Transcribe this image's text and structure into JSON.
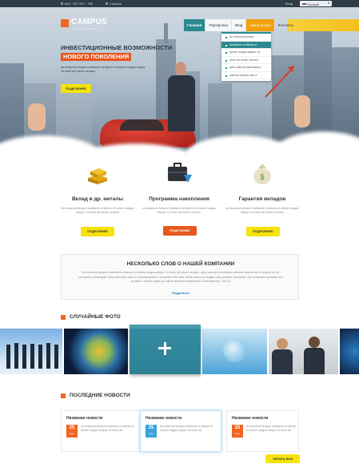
{
  "topbar": {
    "phone": "800 - 567 907 - 785",
    "skype": "Campus",
    "login": "Вход",
    "language": "Русский"
  },
  "brand": {
    "name": "CAMPUS",
    "tagline": "Тема для бизнеса"
  },
  "nav": {
    "items": [
      {
        "label": "Главная",
        "state": "active"
      },
      {
        "label": "Портфолио",
        "state": "normal"
      },
      {
        "label": "Blog",
        "state": "normal"
      },
      {
        "label": "Наши услуги",
        "state": "hover"
      },
      {
        "label": "Контакты",
        "state": "normal"
      }
    ]
  },
  "dropdown": {
    "items": [
      "do eiusmod tempor",
      "incididunt ut labore et",
      "dolore magna aliqua. Ut",
      "enim ad minim veniam,",
      "quis nostrud exercitation",
      "ullamco laboris nisi ut"
    ]
  },
  "hero": {
    "title": "ИНВЕСТИЦИОННЫЕ ВОЗМОЖНОСТИ",
    "accent": "НОВОГО ПОКОЛЕНИЯ",
    "text": "do eiusmod tempor incididunt ut labore et dolore magna aliqua. Ut enim ad minim veniam",
    "button": "ПОДРОБНЕЕ"
  },
  "features": [
    {
      "icon": "gold-bars-icon",
      "title": "Вклад в др. металы",
      "text": "do eiusmod tempor incididunt ut labore et dolore magna aliqua. Ut enim ad minim veniam",
      "button": "ПОДРОБНЕЕ"
    },
    {
      "icon": "briefcase-icon",
      "title": "Программа накопления",
      "text": "do eiusmod tempor incididunt ut labore et dolore magna aliqua. Ut enim ad minim veniam",
      "button": "ПОДРОБНЕЕ"
    },
    {
      "icon": "money-bag-icon",
      "title": "Гарантия вкладов",
      "text": "do eiusmod tempor incididunt ut labore et dolore magna aliqua. Ut enim ad minim veniam",
      "button": "ПОДРОБНЕЕ"
    }
  ],
  "about": {
    "title": "НЕСКОЛЬКО СЛОВ О НАШЕЙ КОМПАНИИ",
    "text": "do eiusmod tempor incididunt ut labore et dolore magna aliqua. Ut enim ad minim veniam, quis nostrud exercitation ullamco laboris nisi ut aliquip ex ea commodo consequat. Duis aute irure dolor in reprehenderit in voluptate velit esse cillum dolore eu fugiat nulla pariatur. Excepteur sint occaecat cupidatat non proident, sunt in culpa qui officia deserunt mollit anim id est laborum. Sed ut",
    "link": "Подробнее"
  },
  "photos": {
    "title": "СЛУЧАЙНЫЕ ФОТО"
  },
  "news": {
    "title": "ПОСЛЕДНИЕ НОВОСТИ",
    "items": [
      {
        "title": "Название новости",
        "day": "25",
        "month": "мар",
        "text": "do eiusmod tempor incididunt ut labore et dolore magna aliqua. Ut enim ad",
        "date_color": "#f26522"
      },
      {
        "title": "Название новости",
        "day": "25",
        "month": "мар",
        "text": "do eiusmod tempor incididunt ut labore et dolore magna aliqua. Ut enim ad",
        "date_color": "#3aa3d6"
      },
      {
        "title": "Название новости",
        "day": "25",
        "month": "мар",
        "text": "do eiusmod tempor incididunt ut labore et dolore magna aliqua. Ut enim ad",
        "date_color": "#f26522"
      }
    ],
    "read_all": "ЧИТАТЬ ВСЕ"
  },
  "colors": {
    "accent": "#f26522",
    "teal": "#2a8a8f",
    "yellow": "#f5e30b",
    "orange": "#e5581d"
  }
}
